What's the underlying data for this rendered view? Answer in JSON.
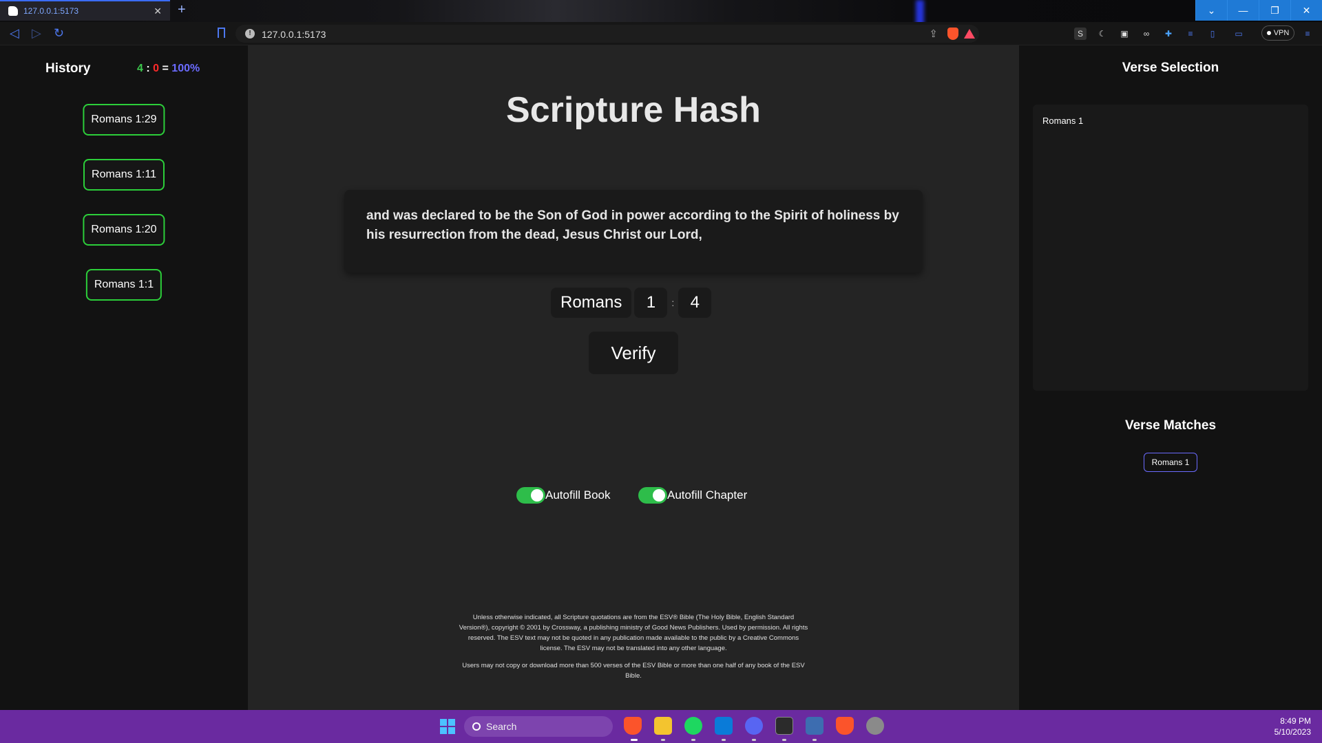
{
  "browser": {
    "tab_title": "127.0.0.1:5173",
    "url": "127.0.0.1:5173",
    "new_tab_glyph": "+",
    "vpn_label": "VPN"
  },
  "history": {
    "title": "History",
    "score": {
      "correct": "4",
      "wrong": "0",
      "percent": "100%",
      "sep1": ":",
      "sep2": "="
    },
    "items": [
      "Romans 1:29",
      "Romans 1:11",
      "Romans 1:20",
      "Romans 1:1"
    ]
  },
  "main": {
    "title": "Scripture Hash",
    "verse_text": "and was declared to be the Son of God in power according to the Spirit of holiness by his resurrection from the dead, Jesus Christ our Lord,",
    "reference": {
      "book": "Romans",
      "chapter": "1",
      "colon": ":",
      "verse": "4"
    },
    "verify_label": "Verify",
    "toggles": [
      {
        "label": "Autofill Book",
        "on": true
      },
      {
        "label": "Autofill Chapter",
        "on": true
      }
    ],
    "legal_p1": "Unless otherwise indicated, all Scripture quotations are from the ESV® Bible (The Holy Bible, English Standard Version®), copyright © 2001 by Crossway, a publishing ministry of Good News Publishers. Used by permission. All rights reserved. The ESV text may not be quoted in any publication made available to the public by a Creative Commons license. The ESV may not be translated into any other language.",
    "legal_p2": "Users may not copy or download more than 500 verses of the ESV Bible or more than one half of any book of the ESV Bible."
  },
  "verse_selection": {
    "title": "Verse Selection",
    "items": [
      "Romans 1"
    ]
  },
  "verse_matches": {
    "title": "Verse Matches",
    "items": [
      "Romans 1"
    ]
  },
  "taskbar": {
    "search_label": "Search",
    "time": "8:49 PM",
    "date": "5/10/2023"
  },
  "colors": {
    "correct": "#3cc94d",
    "wrong": "#ff2a2a",
    "percent": "#6b6bff",
    "history_border": "#2ccf3a",
    "toggle_on": "#2ebd4a",
    "taskbar": "#6a2aa0"
  }
}
